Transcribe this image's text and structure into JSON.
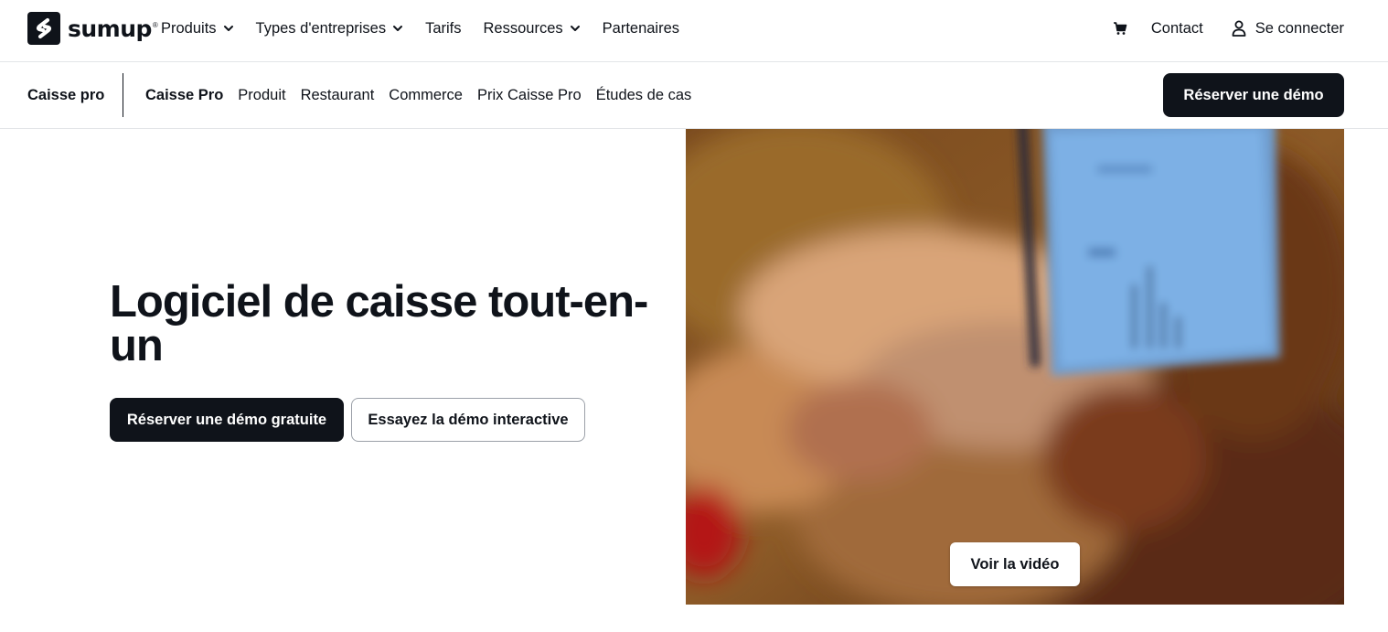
{
  "brand": {
    "name": "sumup",
    "registered": "®"
  },
  "main_nav": [
    {
      "label": "Produits",
      "dropdown": true
    },
    {
      "label": "Types d'entreprises",
      "dropdown": true
    },
    {
      "label": "Tarifs",
      "dropdown": false
    },
    {
      "label": "Ressources",
      "dropdown": true
    },
    {
      "label": "Partenaires",
      "dropdown": false
    }
  ],
  "right_nav": {
    "cart_icon": "cart-icon",
    "contact_label": "Contact",
    "login_label": "Se connecter",
    "login_icon": "user-icon"
  },
  "sub_nav": {
    "title": "Caisse pro",
    "items": [
      {
        "label": "Caisse Pro",
        "active": true
      },
      {
        "label": "Produit",
        "active": false
      },
      {
        "label": "Restaurant",
        "active": false
      },
      {
        "label": "Commerce",
        "active": false
      },
      {
        "label": "Prix Caisse Pro",
        "active": false
      },
      {
        "label": "Études de cas",
        "active": false
      }
    ],
    "cta_label": "Réserver une démo"
  },
  "hero": {
    "title": "Logiciel de caisse tout-en-un",
    "primary_cta": "Réserver une démo gratuite",
    "secondary_cta": "Essayez la démo interactive",
    "video_button": "Voir la vidéo"
  },
  "colors": {
    "text": "#0f131a",
    "primary": "#0f131a",
    "border": "#e3e5e8",
    "video_base": "#6b3a15"
  }
}
